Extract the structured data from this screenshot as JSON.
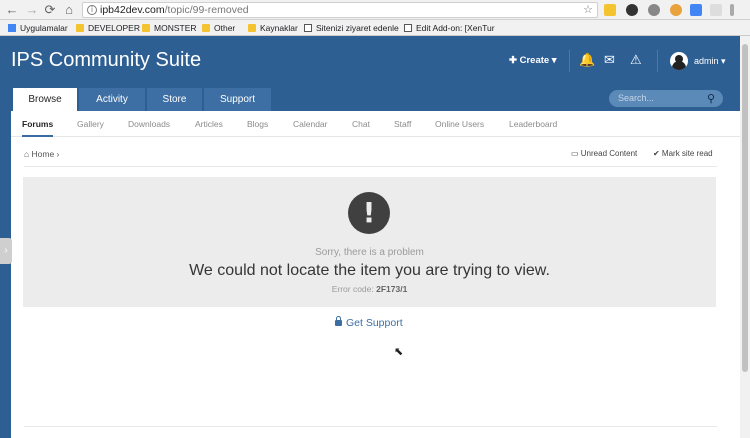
{
  "browser": {
    "back": "←",
    "forward": "→",
    "reload": "⟳",
    "home": "⌂",
    "address": "ipb42dev.com",
    "address_path": "/topic/99-removed",
    "info_icon": "i",
    "star_icon": "☆",
    "bookmarks": [
      {
        "label": "Uygulamalar",
        "icon": "grid"
      },
      {
        "label": "DEVELOPER",
        "icon": "folder"
      },
      {
        "label": "MONSTER",
        "icon": "folder"
      },
      {
        "label": "Other",
        "icon": "folder"
      },
      {
        "label": "Kaynaklar",
        "icon": "folder"
      },
      {
        "label": "Sitenizi ziyaret edenle",
        "icon": "page"
      },
      {
        "label": "Edit Add-on: [XenTur",
        "icon": "page"
      }
    ]
  },
  "header": {
    "brand": "IPS Community Suite",
    "create": "✚ Create ▾",
    "bell": "🔔",
    "mail": "✉",
    "warning": "⚠",
    "user": "admin ▾"
  },
  "tabs": [
    {
      "label": "Browse",
      "active": true
    },
    {
      "label": "Activity"
    },
    {
      "label": "Store"
    },
    {
      "label": "Support"
    }
  ],
  "search": {
    "placeholder": "Search...",
    "icon": "⚲"
  },
  "subnav": [
    "Forums",
    "Gallery",
    "Downloads",
    "Articles",
    "Blogs",
    "Calendar",
    "Chat",
    "Staff",
    "Online Users",
    "Leaderboard"
  ],
  "breadcrumb": {
    "home": "⌂ Home ›",
    "unread": "▭ Unread Content",
    "mark_read": "✔ Mark site read"
  },
  "error": {
    "icon": "!",
    "subtitle": "Sorry, there is a problem",
    "message": "We could not locate the item you are trying to view.",
    "code_label": "Error code:",
    "code": "2F173/1"
  },
  "support_link": "Get Support",
  "side_handle": "›",
  "colors": {
    "header": "#2d5f93",
    "tab": "#3d6fa4",
    "accent": "#3c6ea3",
    "error_bg": "#ececec"
  }
}
